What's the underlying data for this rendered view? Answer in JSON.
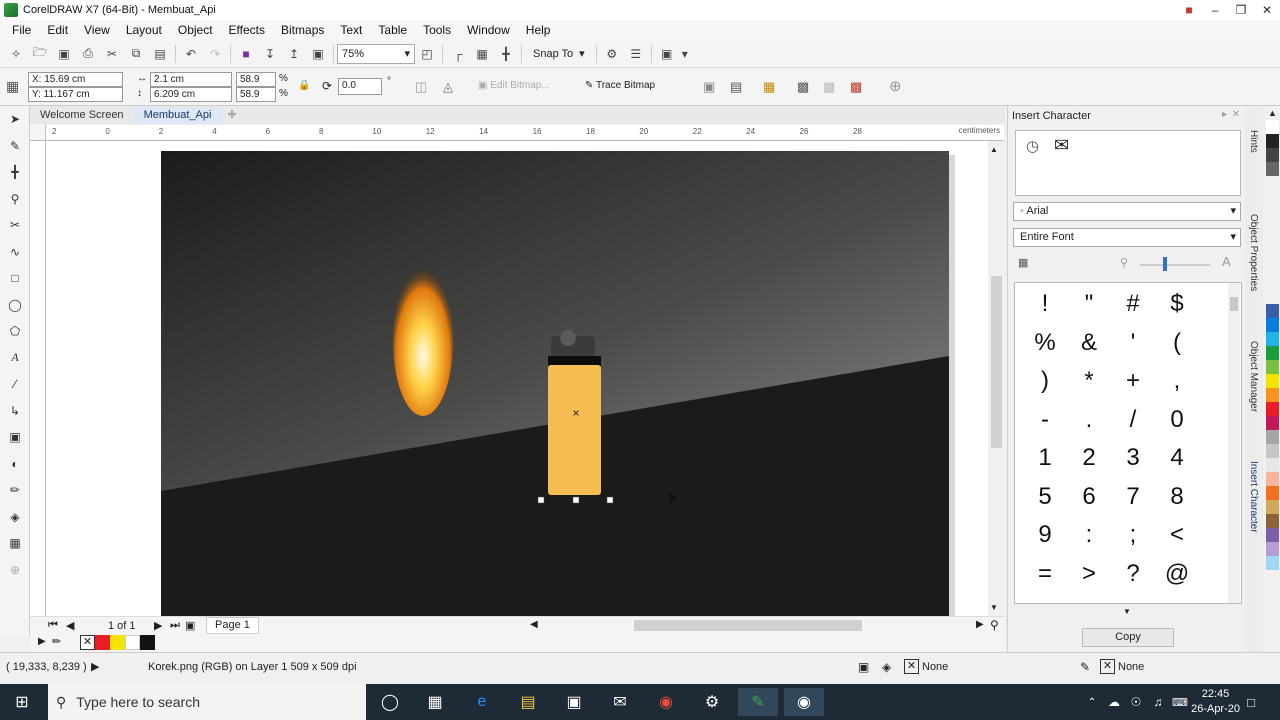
{
  "window": {
    "title": "CorelDRAW X7 (64-Bit) - Membuat_Api"
  },
  "menu": [
    {
      "label": "File"
    },
    {
      "label": "Edit"
    },
    {
      "label": "View"
    },
    {
      "label": "Layout"
    },
    {
      "label": "Object"
    },
    {
      "label": "Effects"
    },
    {
      "label": "Bitmaps"
    },
    {
      "label": "Text"
    },
    {
      "label": "Table"
    },
    {
      "label": "Tools"
    },
    {
      "label": "Window"
    },
    {
      "label": "Help"
    }
  ],
  "standard_bar": {
    "zoom": "75%",
    "snap_to": "Snap To"
  },
  "property_bar": {
    "x": "X: 15.69 cm",
    "y": "Y: 11.167 cm",
    "w": "2.1 cm",
    "h": "6.209 cm",
    "scale_w": "58.9",
    "scale_h": "58.9",
    "pct": "%",
    "angle": "0.0",
    "deg": "°",
    "edit_bitmap": "Edit Bitmap...",
    "trace_bitmap": "Trace Bitmap"
  },
  "doc_tabs": [
    {
      "label": "Welcome Screen"
    },
    {
      "label": "Membuat_Api"
    }
  ],
  "ruler": {
    "h_ticks": [
      "2",
      "0",
      "2",
      "4",
      "6",
      "8",
      "10",
      "12",
      "14",
      "16",
      "18",
      "20",
      "22",
      "24",
      "26",
      "28"
    ],
    "unit": "centimeters"
  },
  "page_nav": {
    "count": "1 of 1",
    "page": "Page 1"
  },
  "status": {
    "coords": "( 19,333, 8,239 )",
    "object_info": "Korek.png (RGB) on Layer 1 509 x 509 dpi",
    "fill": "None",
    "outline": "None"
  },
  "docker": {
    "title": "Insert Character",
    "font": "Arial",
    "range": "Entire Font",
    "chars": [
      "!",
      "\"",
      "#",
      "$",
      "%",
      "&",
      "'",
      "(",
      ")",
      "*",
      "+",
      ",",
      "-",
      ".",
      "/",
      "0",
      "1",
      "2",
      "3",
      "4",
      "5",
      "6",
      "7",
      "8",
      "9",
      ":",
      ";",
      "<",
      "=",
      ">",
      "?",
      "@"
    ],
    "copy_label": "Copy"
  },
  "side_tabs": [
    "Hints",
    "Object Properties",
    "Object Manager",
    "Insert Character"
  ],
  "palette_colors": [
    "#ffffff",
    "#222222",
    "#444444",
    "#666666",
    "#3a5ea8",
    "#0a7de0",
    "#1eb4e6",
    "#1c9c3c",
    "#7ac142",
    "#f2e400",
    "#f7941d",
    "#e81d25",
    "#c2185b",
    "#a6a6a6",
    "#c6c6c6",
    "#e6e6e6",
    "#f9b49b",
    "#f36f21",
    "#d2a85c",
    "#8c6239",
    "#7b5fa8",
    "#b49dd1",
    "#9fd7f5"
  ],
  "taskbar": {
    "search_placeholder": "Type here to search",
    "time": "22:45",
    "date": "26-Apr-20"
  }
}
